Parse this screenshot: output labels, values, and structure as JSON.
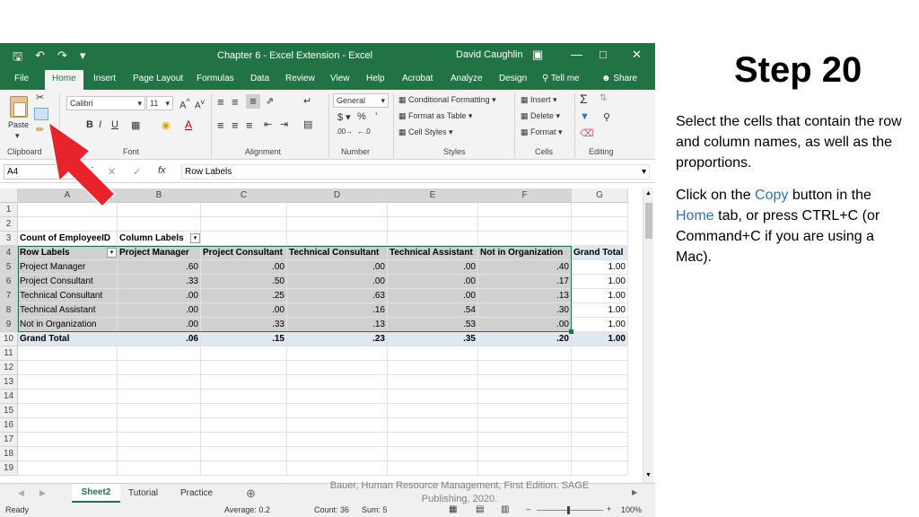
{
  "slide": {
    "step_title": "Step 20",
    "instr1": "Select the cells that contain the row and column names, as well as the proportions.",
    "instr2_a": "Click on the ",
    "instr2_copy": "Copy",
    "instr2_b": " button in the ",
    "instr2_home": "Home",
    "instr2_c": " tab, or press CTRL+C (or Command+C if you are using a Mac).",
    "citation": "Bauer, Human Resource Management, First Edition. SAGE Publishing, 2020.",
    "accent": "#2e75b6",
    "arrow_color": "#e8232a"
  },
  "excel": {
    "title": "Chapter 6 - Excel Extension  -  Excel",
    "user": "David Caughlin",
    "tabs": [
      "File",
      "Home",
      "Insert",
      "Page Layout",
      "Formulas",
      "Data",
      "Review",
      "View",
      "Help",
      "Acrobat",
      "Analyze",
      "Design",
      "Tell me",
      "Share"
    ],
    "ribbon": {
      "paste": "Paste",
      "font_name": "Calibri",
      "font_size": "11",
      "number_format": "General",
      "conditional": "Conditional Formatting",
      "format_table": "Format as Table",
      "cell_styles": "Cell Styles",
      "insert": "Insert",
      "delete": "Delete",
      "format": "Format",
      "groups": [
        "Clipboard",
        "Font",
        "Alignment",
        "Number",
        "Styles",
        "Cells",
        "Editing"
      ]
    },
    "namebox": "A4",
    "formula": "Row Labels",
    "columns": [
      "A",
      "B",
      "C",
      "D",
      "E",
      "F",
      "G"
    ],
    "rows": [
      "1",
      "2",
      "3",
      "4",
      "5",
      "6",
      "7",
      "8",
      "9",
      "10",
      "11",
      "12",
      "13",
      "14",
      "15",
      "16",
      "17",
      "18",
      "19"
    ],
    "pivot": {
      "r3a": "Count of EmployeeID",
      "r3b": "Column Labels",
      "headers": [
        "Row Labels",
        "Project Manager",
        "Project Consultant",
        "Technical Consultant",
        "Technical Assistant",
        "Not in Organization",
        "Grand Total"
      ],
      "data": [
        [
          "Project Manager",
          ".60",
          ".00",
          ".00",
          ".00",
          ".40",
          "1.00"
        ],
        [
          "Project Consultant",
          ".33",
          ".50",
          ".00",
          ".00",
          ".17",
          "1.00"
        ],
        [
          "Technical Consultant",
          ".00",
          ".25",
          ".63",
          ".00",
          ".13",
          "1.00"
        ],
        [
          "Technical Assistant",
          ".00",
          ".00",
          ".16",
          ".54",
          ".30",
          "1.00"
        ],
        [
          "Not in Organization",
          ".00",
          ".33",
          ".13",
          ".53",
          ".00",
          "1.00"
        ]
      ],
      "total": [
        "Grand Total",
        ".06",
        ".15",
        ".23",
        ".35",
        ".20",
        "1.00"
      ]
    },
    "sheet_tabs": [
      "Sheet2",
      "Tutorial",
      "Practice"
    ],
    "status": {
      "ready": "Ready",
      "average": "Average: 0.2",
      "count": "Count: 36",
      "sum": "Sum: 5",
      "zoom": "100%"
    }
  }
}
